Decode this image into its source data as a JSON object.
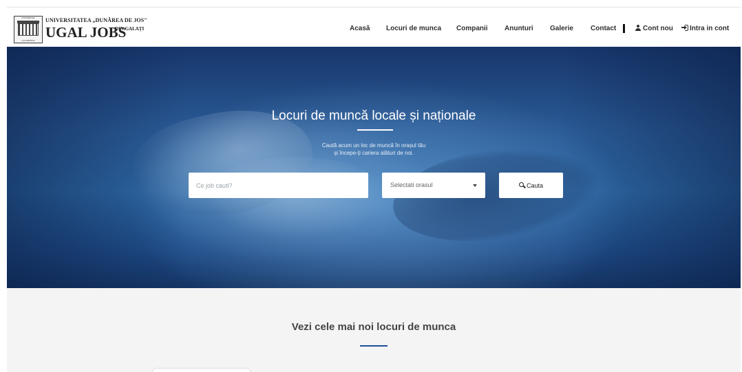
{
  "brand": {
    "seal_top_text": "UNIVERSITAS",
    "seal_bottom_text": "GALATIENSIS",
    "university_line": "UNIVERSITATEA „DUNĂREA DE JOS\"",
    "name": "UGAL JOBS",
    "city_line": "DIN GALAȚI"
  },
  "nav": {
    "items": [
      {
        "label": "Acasă"
      },
      {
        "label": "Locuri de munca"
      },
      {
        "label": "Companii"
      },
      {
        "label": "Anunturi"
      },
      {
        "label": "Galerie"
      },
      {
        "label": "Contact"
      }
    ],
    "register": {
      "label": "Cont nou",
      "icon": "user-icon"
    },
    "login": {
      "label": "Intra in cont",
      "icon": "sign-in-icon"
    }
  },
  "hero": {
    "title": "Locuri de muncă locale și naționale",
    "subtitle_line1": "Caută acum un loc de muncă în orașul tău",
    "subtitle_line2": "și începe-ți cariera alături de noi."
  },
  "search": {
    "job_placeholder": "Ce job cauti?",
    "city_selected": "Selectati orasul",
    "button_label": "Cauta",
    "button_icon": "search-icon"
  },
  "latest": {
    "title": "Vezi cele mai noi locuri de munca"
  },
  "colors": {
    "accent": "#1c4e9c",
    "hero_dark": "#17366b",
    "hero_light": "#2e6aa6"
  }
}
